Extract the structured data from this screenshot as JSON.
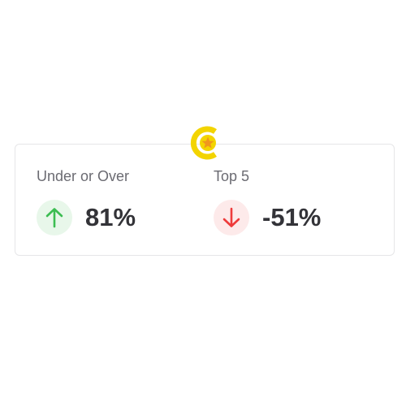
{
  "logo": {
    "icon": "coin-star-icon",
    "colors": {
      "ring": "#f3d400",
      "star": "#f0961e"
    }
  },
  "stats": [
    {
      "label": "Under or Over",
      "value": "81%",
      "trend": "up",
      "icon": "arrow-up-icon",
      "color": "#3cbd52"
    },
    {
      "label": "Top 5",
      "value": "-51%",
      "trend": "down",
      "icon": "arrow-down-icon",
      "color": "#ee3b3b"
    }
  ]
}
